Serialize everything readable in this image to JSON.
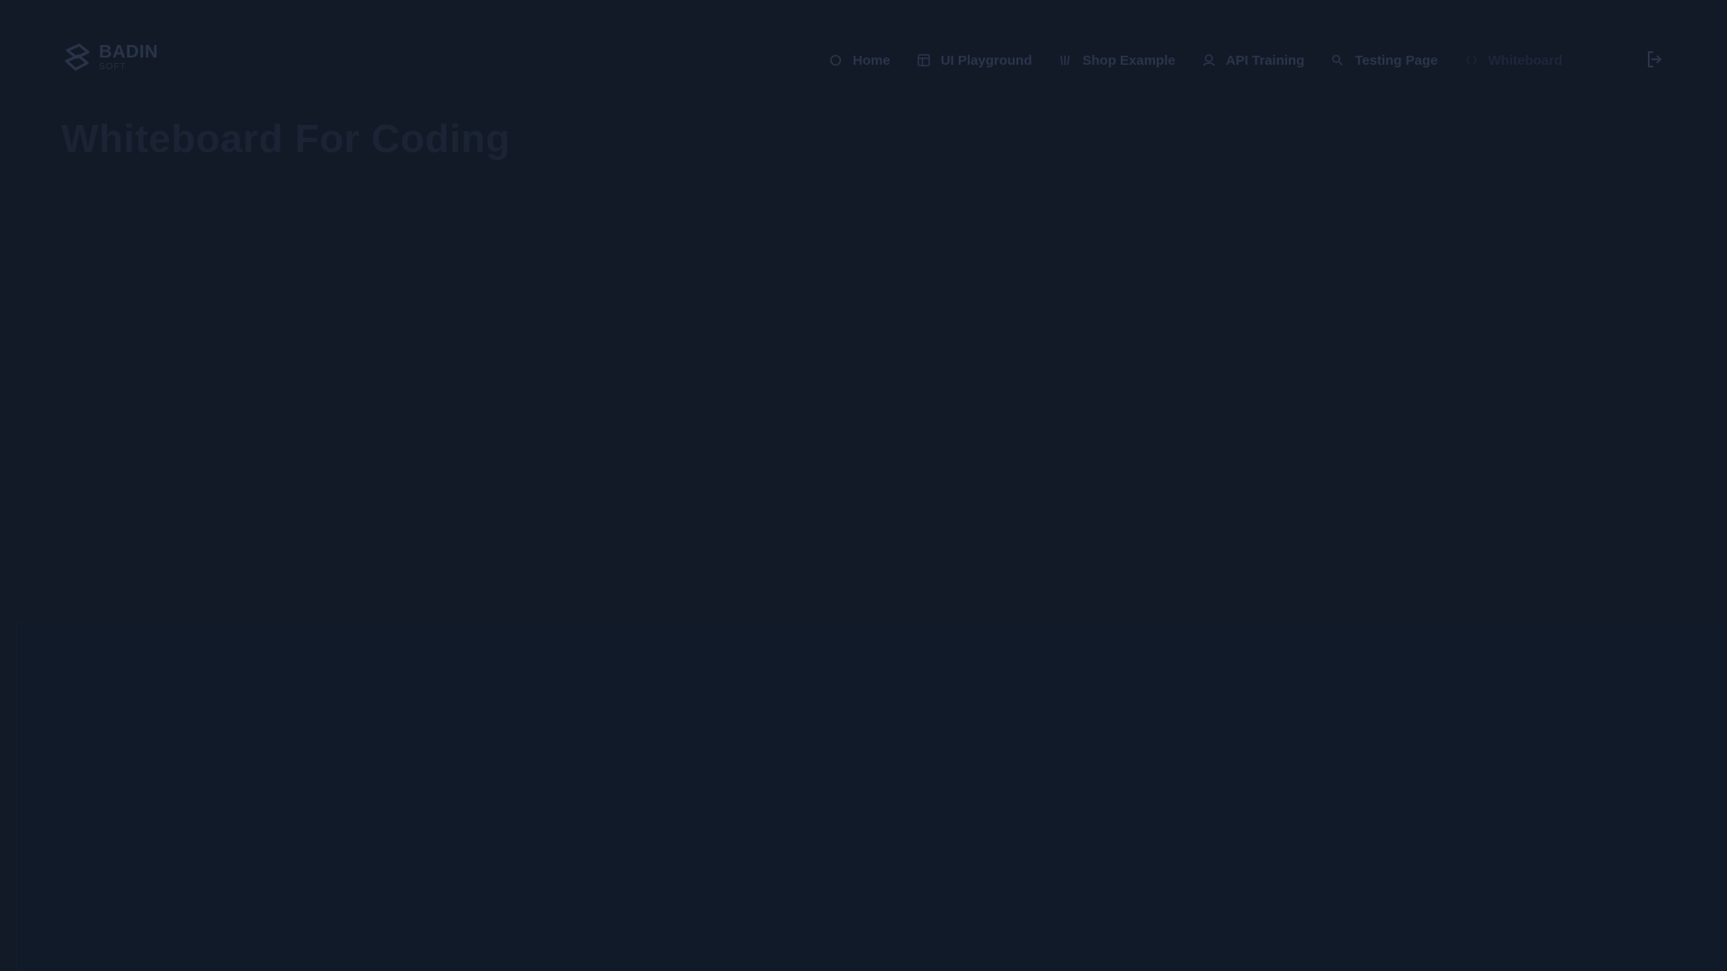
{
  "brand": {
    "name": "BADIN",
    "subtitle": "SOFT",
    "logo_icon": "badin-logo-icon"
  },
  "nav": {
    "items": [
      {
        "label": "Home",
        "icon": "home-icon"
      },
      {
        "label": "UI Playground",
        "icon": "layout-icon"
      },
      {
        "label": "Shop Example",
        "icon": "shop-icon"
      },
      {
        "label": "API Training",
        "icon": "api-icon"
      },
      {
        "label": "Testing Page",
        "icon": "search-icon"
      },
      {
        "label": "Whiteboard",
        "icon": "code-icon",
        "active": true
      }
    ],
    "logout_icon": "logout-icon"
  },
  "page": {
    "title": "Whiteboard For Coding"
  },
  "colors": {
    "background": "#121a28",
    "nav_text": "#2a354a",
    "title": "#1b2434"
  }
}
